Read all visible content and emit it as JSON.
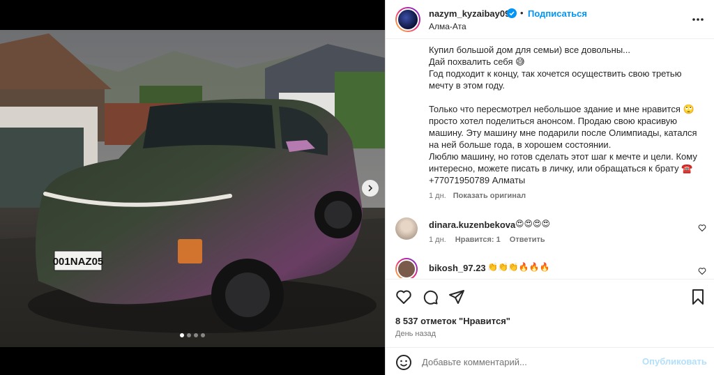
{
  "post": {
    "username": "nazym_kyzaibay09",
    "dot": "•",
    "follow_label": "Подписаться",
    "location": "Алма-Ата",
    "more_icon": "more-horizontal-icon"
  },
  "caption": {
    "text": "Купил большой дом для семьи) все довольны...\nДай похвалить себя 😅\nГод подходит к концу, так хочется осуществить свою третью мечту в этом году.\n\nТолько что пересмотрел небольшое здание и мне нравится 🙄 просто хотел поделиться анонсом. Продаю свою красивую машину. Эту машину мне подарили после Олимпиады, катался на ней больше года, в хорошем состоянии.\nЛюблю машину, но готов сделать этот шаг к мечте и цели. Кому интересно, можете писать в личку, или обращаться к брату ☎️ +77071950789 Алматы",
    "time": "1 дн.",
    "see_original": "Показать оригинал"
  },
  "comments": [
    {
      "username": "dinara.kuzenbekova",
      "text": "😍😍😍😍",
      "time": "1 дн.",
      "likes": "Нравится: 1",
      "reply": "Ответить"
    },
    {
      "username": "bikosh_97.23",
      "text": "👏👏👏🔥🔥🔥"
    }
  ],
  "photo": {
    "plate": "001NAZ05",
    "plate_region": "KZ",
    "carousel_total": 4,
    "carousel_active": 1
  },
  "actions": {
    "like_icon": "heart-icon",
    "comment_icon": "comment-icon",
    "share_icon": "send-icon",
    "save_icon": "bookmark-icon"
  },
  "stats": {
    "likes": "8 537 отметок \"Нравится\"",
    "date": "День назад"
  },
  "add_comment": {
    "placeholder": "Добавьте комментарий...",
    "publish_label": "Опубликовать"
  },
  "colors": {
    "accent": "#0095f6",
    "publish_disabled": "#b2dffc",
    "text": "#262626",
    "secondary": "#737373"
  }
}
